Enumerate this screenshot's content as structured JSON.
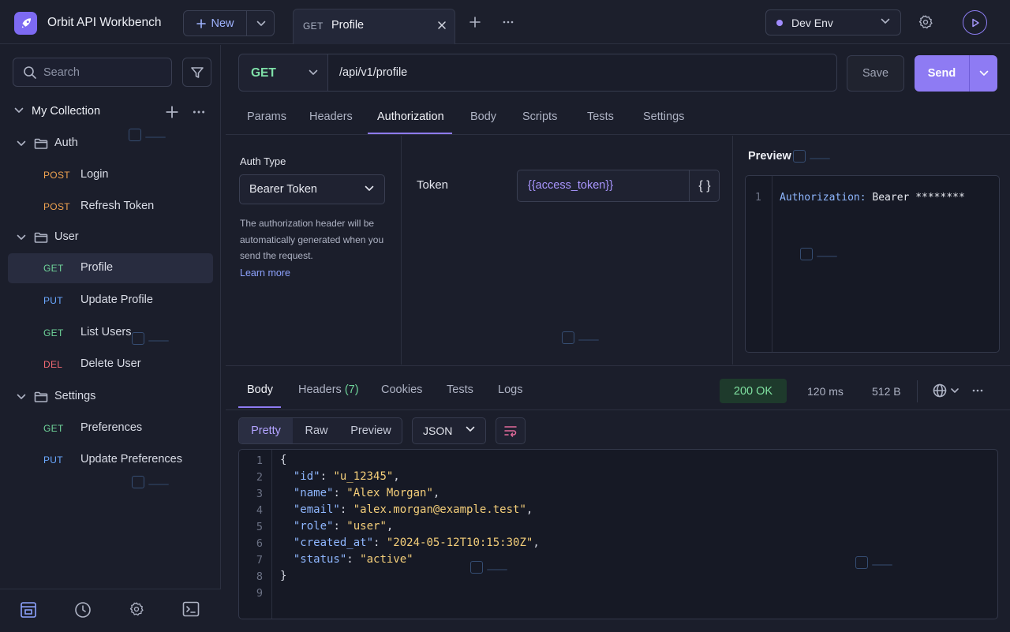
{
  "app": {
    "title": "Orbit API Workbench"
  },
  "toolbar": {
    "new_label": "New"
  },
  "tab": {
    "method": "GET",
    "name": "Profile"
  },
  "environment": {
    "label": "Dev Env"
  },
  "sidebar": {
    "search_placeholder": "Search",
    "collection_name": "My Collection",
    "folders": {
      "auth": "Auth",
      "user": "User",
      "settings": "Settings"
    },
    "requests": [
      {
        "method": "POST",
        "label": "Login"
      },
      {
        "method": "POST",
        "label": "Refresh Token"
      },
      {
        "method": "GET",
        "label": "Profile"
      },
      {
        "method": "PUT",
        "label": "Update Profile"
      },
      {
        "method": "GET",
        "label": "List Users"
      },
      {
        "method": "DEL",
        "label": "Delete User"
      },
      {
        "method": "GET",
        "label": "Preferences"
      },
      {
        "method": "PUT",
        "label": "Update Preferences"
      }
    ]
  },
  "request": {
    "method": "GET",
    "url": "/api/v1/profile",
    "save_label": "Save",
    "send_label": "Send",
    "tabs": [
      "Params",
      "Headers",
      "Authorization",
      "Body",
      "Scripts",
      "Tests",
      "Settings"
    ],
    "active_tab": "Authorization"
  },
  "auth": {
    "type_label": "Auth Type",
    "type_value": "Bearer Token",
    "description": "The authorization header will be automatically generated when you send the request.",
    "learn_more": "Learn more",
    "token_label": "Token",
    "token_value": "{{access_token}}",
    "var_button": "{ }"
  },
  "preview": {
    "title": "Preview",
    "line_number": "1",
    "header_key": "Authorization:",
    "header_value": " Bearer ********"
  },
  "response": {
    "tabs": {
      "body": "Body",
      "headers": "Headers",
      "headers_count": "(7)",
      "cookies": "Cookies",
      "tests": "Tests",
      "logs": "Logs"
    },
    "status": "200 OK",
    "time": "120 ms",
    "size": "512 B",
    "views": [
      "Pretty",
      "Raw",
      "Preview"
    ],
    "format": "JSON",
    "line_numbers": [
      "1",
      "2",
      "3",
      "4",
      "5",
      "6",
      "7",
      "8",
      "9"
    ],
    "body_fields": [
      {
        "key": "\"id\"",
        "value": "\"u_12345\""
      },
      {
        "key": "\"name\"",
        "value": "\"Alex Morgan\""
      },
      {
        "key": "\"email\"",
        "value": "\"alex.morgan@example.test\""
      },
      {
        "key": "\"role\"",
        "value": "\"user\""
      },
      {
        "key": "\"created_at\"",
        "value": "\"2024-05-12T10:15:30Z\""
      },
      {
        "key": "\"status\"",
        "value": "\"active\""
      }
    ],
    "open_brace": "{",
    "close_brace": "}"
  },
  "colors": {
    "accent": "#8e7bf3",
    "get": "#6fd49a",
    "post": "#f0a350",
    "put": "#6aa8ff",
    "del": "#f06a73",
    "status_ok": "#7fe0a0"
  },
  "icons": [
    "rocket-icon",
    "plus-icon",
    "chevron-down-icon",
    "close-icon",
    "more-icon",
    "gear-icon",
    "play-icon",
    "search-icon",
    "filter-icon",
    "folder-icon",
    "collection-icon",
    "history-icon",
    "terminal-icon",
    "globe-icon",
    "wrap-icon"
  ]
}
